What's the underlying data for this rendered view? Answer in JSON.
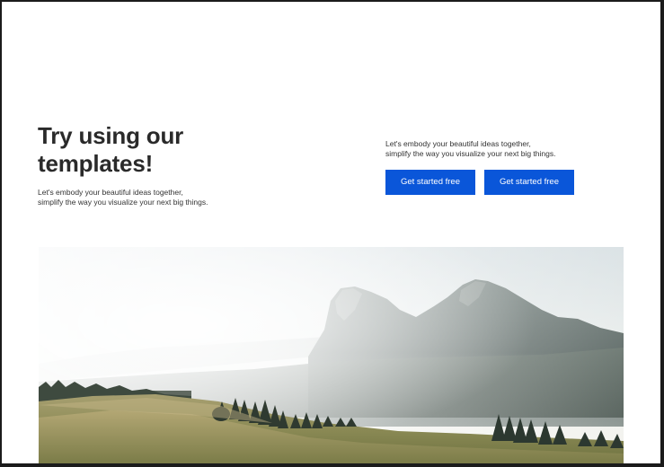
{
  "hero": {
    "title_line1": "Try using our",
    "title_line2": "templates!",
    "description_line1": "Let's embody your beautiful ideas together,",
    "description_line2": "simplify the way you visualize your next big things."
  },
  "cta_section": {
    "description_line1": "Let's embody your beautiful ideas together,",
    "description_line2": "simplify the way you visualize your next big things.",
    "primary_button_label": "Get started free",
    "secondary_button_label": "Get started free"
  },
  "colors": {
    "button_bg": "#0a56d9",
    "button_text": "#ffffff",
    "heading_text": "#2a2a2a"
  },
  "image": {
    "subject": "mountain-landscape-photo"
  }
}
